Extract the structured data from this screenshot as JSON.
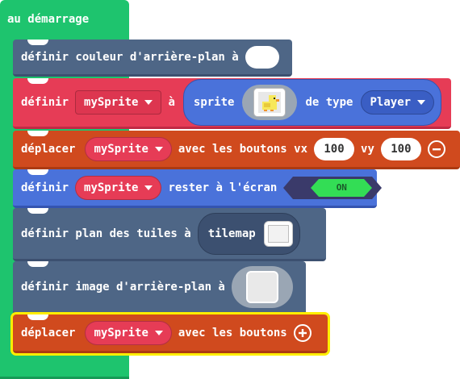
{
  "hat": {
    "label": "au démarrage",
    "color": "#1ec46e"
  },
  "blocks": {
    "set_bg_color": {
      "label": "définir couleur d'arrière-plan à",
      "value_color": "#ffffff"
    },
    "set_sprite": {
      "label_set": "définir",
      "variable": "mySprite",
      "label_to": "à",
      "label_sprite": "sprite",
      "sprite_image": "duck-sprite",
      "label_of_kind": "de type",
      "kind": "Player"
    },
    "move_vx_vy": {
      "label_move": "déplacer",
      "variable": "mySprite",
      "label_with": "avec les boutons vx",
      "vx": "100",
      "label_vy": "vy",
      "vy": "100"
    },
    "stay_in_screen": {
      "label_set": "définir",
      "variable": "mySprite",
      "label_stay": "rester à l'écran",
      "toggle": "ON"
    },
    "set_tilemap": {
      "label": "définir plan des tuiles à",
      "tilemap_label": "tilemap"
    },
    "set_bg_image": {
      "label": "définir image d'arrière-plan à"
    },
    "move_buttons": {
      "label_move": "déplacer",
      "variable": "mySprite",
      "label_with": "avec les boutons"
    }
  },
  "colors": {
    "scene": "#4e6686",
    "sprites": "#e63c56",
    "controller": "#d04a1e",
    "sprite_value": "#4a72da",
    "toggle_on": "#33dd55",
    "selection": "#ffee00"
  }
}
